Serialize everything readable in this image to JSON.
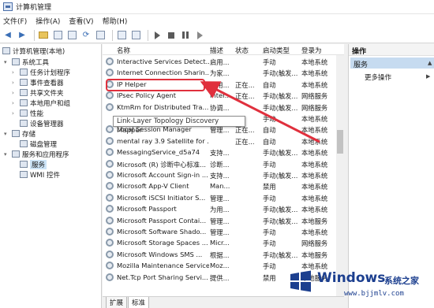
{
  "window": {
    "title": "计算机管理"
  },
  "menu": [
    "文件(F)",
    "操作(A)",
    "查看(V)",
    "帮助(H)"
  ],
  "tree": [
    {
      "label": "计算机管理(本地)",
      "level": 0,
      "arrow": ""
    },
    {
      "label": "系统工具",
      "level": 1,
      "arrow": "▾"
    },
    {
      "label": "任务计划程序",
      "level": 2,
      "arrow": "›"
    },
    {
      "label": "事件查看器",
      "level": 2,
      "arrow": "›"
    },
    {
      "label": "共享文件夹",
      "level": 2,
      "arrow": "›"
    },
    {
      "label": "本地用户和组",
      "level": 2,
      "arrow": "›"
    },
    {
      "label": "性能",
      "level": 2,
      "arrow": "›"
    },
    {
      "label": "设备管理器",
      "level": 2,
      "arrow": ""
    },
    {
      "label": "存储",
      "level": 1,
      "arrow": "▾"
    },
    {
      "label": "磁盘管理",
      "level": 2,
      "arrow": ""
    },
    {
      "label": "服务和应用程序",
      "level": 1,
      "arrow": "▾"
    },
    {
      "label": "服务",
      "level": 2,
      "arrow": "",
      "selected": true
    },
    {
      "label": "WMI 控件",
      "level": 2,
      "arrow": ""
    }
  ],
  "columns": {
    "name": "名称",
    "desc": "描述",
    "status": "状态",
    "start": "启动类型",
    "logon": "登录为"
  },
  "services": [
    {
      "name": "Interactive Services Detect...",
      "desc": "启用...",
      "status": "",
      "start": "手动",
      "logon": "本地系统"
    },
    {
      "name": "Internet Connection Sharin...",
      "desc": "为家...",
      "status": "",
      "start": "手动(触发...",
      "logon": "本地系统"
    },
    {
      "name": "IP Helper",
      "desc": "使用...",
      "status": "正在...",
      "start": "自动",
      "logon": "本地系统"
    },
    {
      "name": "IPsec Policy Agent",
      "desc": "Inter...",
      "status": "正在...",
      "start": "手动(触发...",
      "logon": "网络服务"
    },
    {
      "name": "KtmRm for Distributed Tra...",
      "desc": "协调...",
      "status": "",
      "start": "手动(触发...",
      "logon": "网络服务"
    },
    {
      "name": "",
      "desc": "",
      "status": "",
      "start": "手动",
      "logon": "本地系统"
    },
    {
      "name": "Local Session Manager",
      "desc": "管理...",
      "status": "正在...",
      "start": "自动",
      "logon": "本地系统"
    },
    {
      "name": "mental ray 3.9 Satellite for ...",
      "desc": "",
      "status": "正在...",
      "start": "自动",
      "logon": "本地系统"
    },
    {
      "name": "MessagingService_d5a74",
      "desc": "支持...",
      "status": "",
      "start": "手动(触发...",
      "logon": "本地系统"
    },
    {
      "name": "Microsoft (R) 诊断中心标准...",
      "desc": "诊断...",
      "status": "",
      "start": "手动",
      "logon": "本地系统"
    },
    {
      "name": "Microsoft Account Sign-in ...",
      "desc": "支持...",
      "status": "",
      "start": "手动(触发...",
      "logon": "本地系统"
    },
    {
      "name": "Microsoft App-V Client",
      "desc": "Man...",
      "status": "",
      "start": "禁用",
      "logon": "本地系统"
    },
    {
      "name": "Microsoft iSCSI Initiator S...",
      "desc": "管理...",
      "status": "",
      "start": "手动",
      "logon": "本地系统"
    },
    {
      "name": "Microsoft Passport",
      "desc": "为用...",
      "status": "",
      "start": "手动(触发...",
      "logon": "本地系统"
    },
    {
      "name": "Microsoft Passport Contai...",
      "desc": "管理...",
      "status": "",
      "start": "手动(触发...",
      "logon": "本地服务"
    },
    {
      "name": "Microsoft Software Shado...",
      "desc": "管理...",
      "status": "",
      "start": "手动",
      "logon": "本地系统"
    },
    {
      "name": "Microsoft Storage Spaces ...",
      "desc": "Micr...",
      "status": "",
      "start": "手动",
      "logon": "网络服务"
    },
    {
      "name": "Microsoft Windows SMS ...",
      "desc": "根据...",
      "status": "",
      "start": "手动(触发...",
      "logon": "本地服务"
    },
    {
      "name": "Mozilla Maintenance Service",
      "desc": "Moz...",
      "status": "",
      "start": "手动",
      "logon": "本地系统"
    },
    {
      "name": "Net.Tcp Port Sharing Servi...",
      "desc": "提供...",
      "status": "",
      "start": "禁用",
      "logon": "本地服务"
    }
  ],
  "tooltip": "Link-Layer Topology Discovery Mapper",
  "tabs": [
    "扩展",
    "标准"
  ],
  "actions": {
    "header": "操作",
    "selected": "服务",
    "more": "更多操作"
  },
  "watermark": {
    "title": "Windows",
    "cn": "系统之家",
    "url": "www.bjjmlv.com"
  },
  "colors": {
    "highlight": "#e0303d",
    "selection": "#cce4f7",
    "watermark": "#1c3f8f"
  }
}
